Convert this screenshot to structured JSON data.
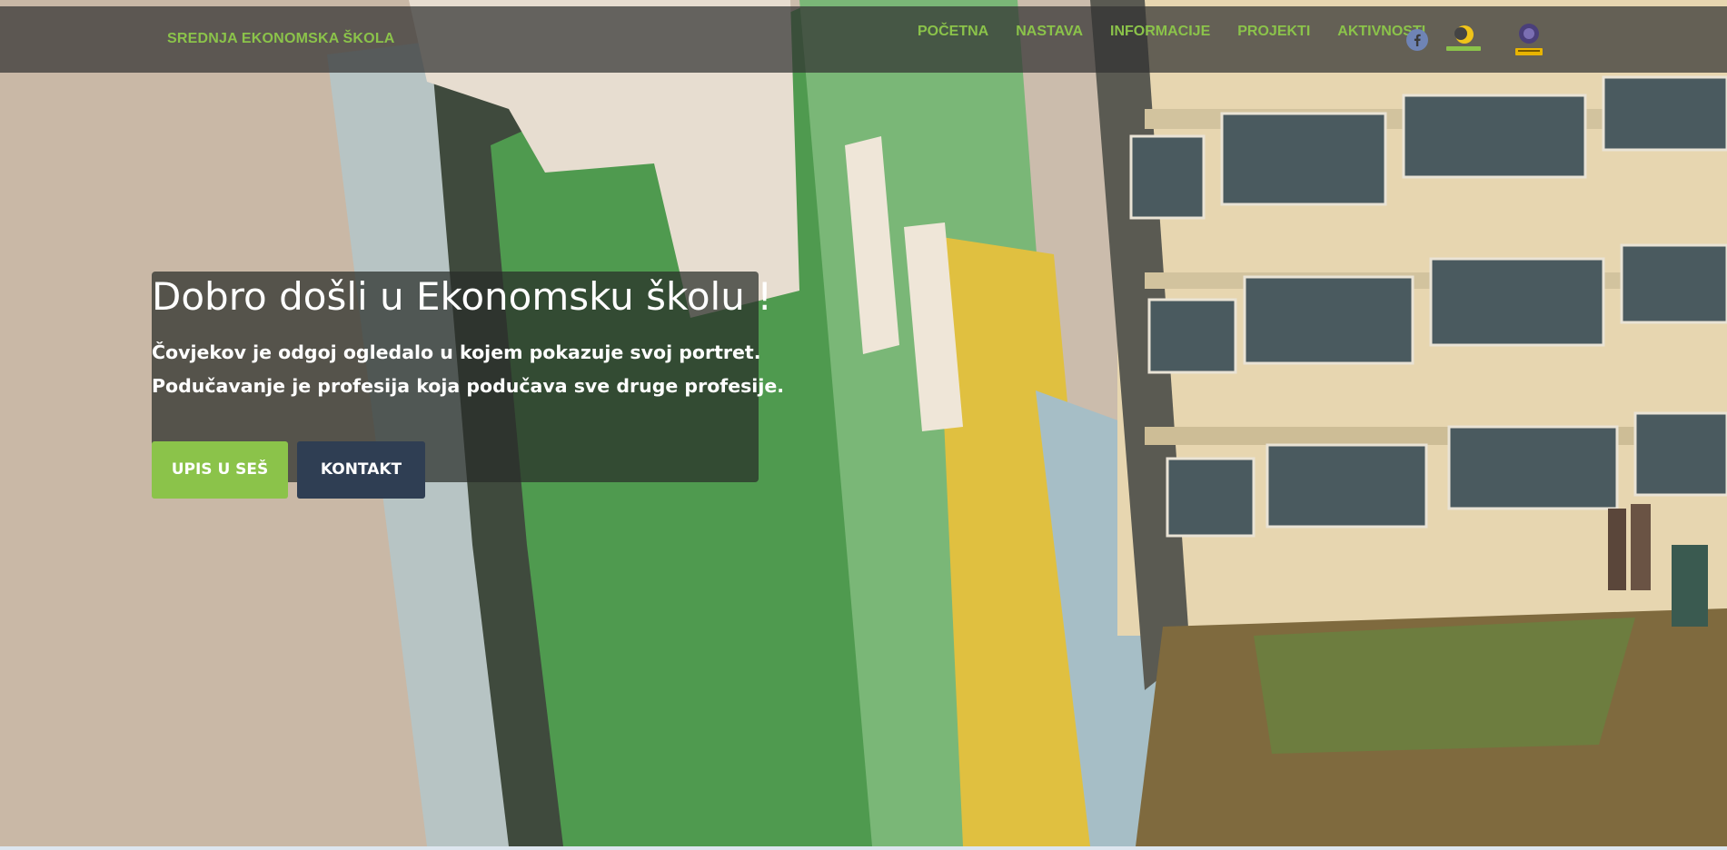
{
  "navbar": {
    "brand": "SREDNJA EKONOMSKA ŠKOLA",
    "links": [
      "POČETNA",
      "NASTAVA",
      "INFORMACIJE",
      "PROJEKTI",
      "AKTIVNOSTI"
    ],
    "icons": [
      "facebook-icon",
      "ekonomija-logo",
      "erasmus-logo"
    ]
  },
  "hero": {
    "title": "Dobro došli u Ekonomsku školu !",
    "quote_line_1": "Čovjekov je odgoj ogledalo u kojem pokazuje svoj portret.",
    "quote_line_2": "Podučavanje je profesija koja podučava sve druge profesije.",
    "buttons": {
      "enroll": "UPIS U SEŠ",
      "contact": "KONTAKT"
    }
  },
  "colors": {
    "accent_green": "#8bc34a",
    "dark_button": "#2f3e53",
    "navbar_bg": "rgba(50,50,50,0.72)"
  }
}
